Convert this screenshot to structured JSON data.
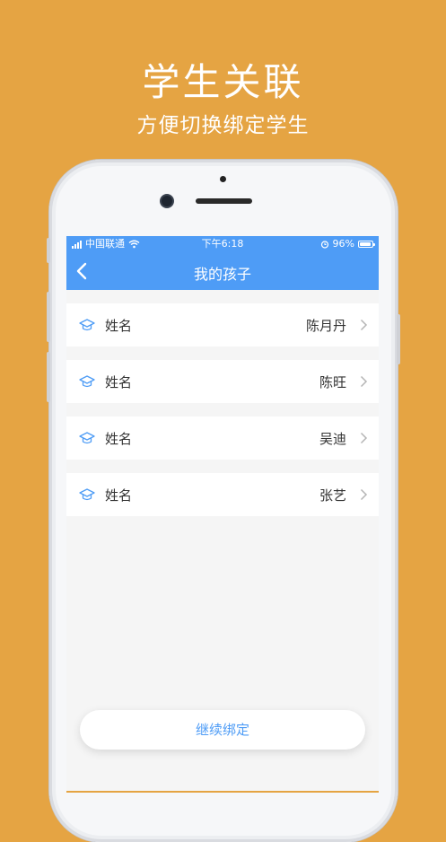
{
  "promo": {
    "title": "学生关联",
    "subtitle": "方便切换绑定学生"
  },
  "status_bar": {
    "carrier": "中国联通",
    "time": "下午6:18",
    "battery": "96%",
    "battery_level": 0.96
  },
  "nav": {
    "title": "我的孩子"
  },
  "students": [
    {
      "label": "姓名",
      "name": "陈月丹"
    },
    {
      "label": "姓名",
      "name": "陈旺"
    },
    {
      "label": "姓名",
      "name": "吴迪"
    },
    {
      "label": "姓名",
      "name": "张艺"
    }
  ],
  "actions": {
    "continue_label": "继续绑定"
  },
  "colors": {
    "background": "#E5A443",
    "accent": "#4E9CF6"
  }
}
